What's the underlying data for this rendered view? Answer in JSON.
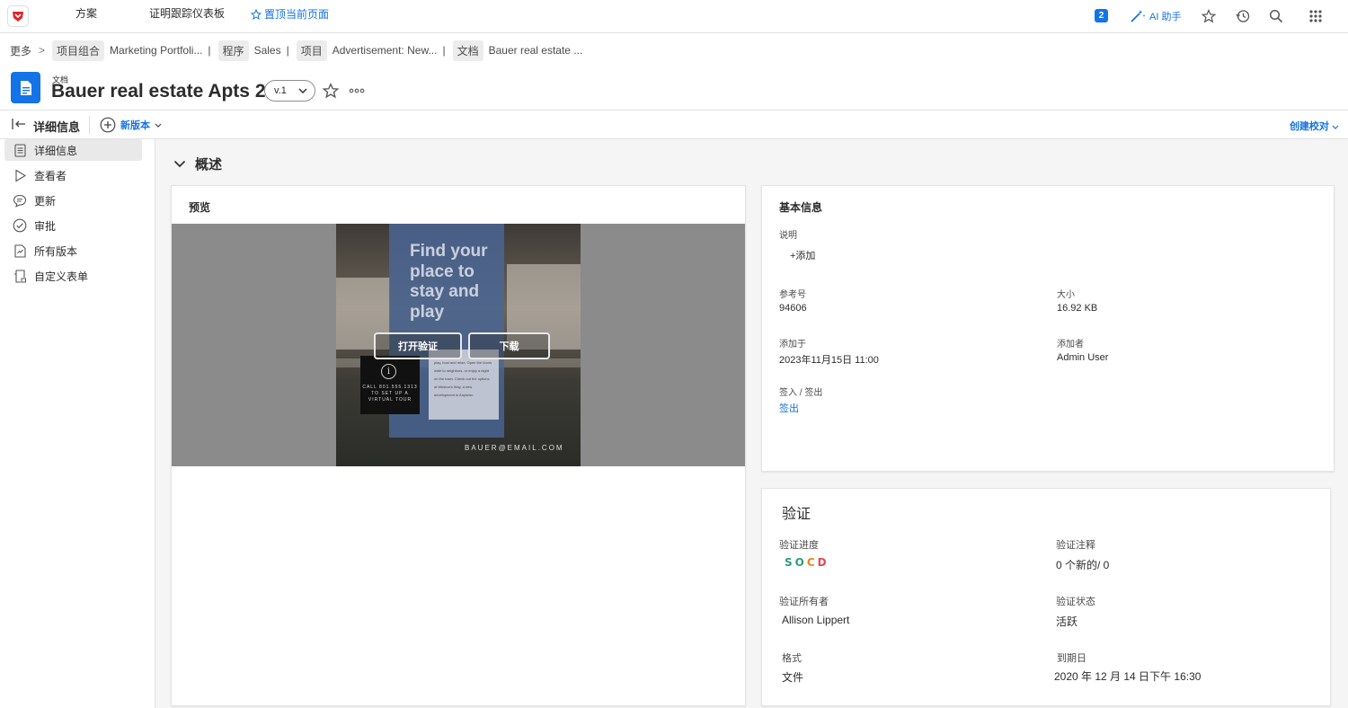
{
  "topbar": {
    "nav_plans": "方案",
    "nav_proof_dashboard": "证明跟踪仪表板",
    "pin_page": "置顶当前页面",
    "notification_count": "2",
    "ai_assistant": "AI 助手"
  },
  "breadcrumb": {
    "more": "更多",
    "items": [
      {
        "type": "项目组合",
        "name": "Marketing Portfoli..."
      },
      {
        "type": "程序",
        "name": "Sales"
      },
      {
        "type": "项目",
        "name": "Advertisement: New..."
      },
      {
        "type": "文档",
        "name": "Bauer real estate ..."
      }
    ]
  },
  "header": {
    "object_type": "文档",
    "title": "Bauer real estate Apts 2",
    "version": "v.1"
  },
  "subtoolbar": {
    "panel_title": "详细信息",
    "new_version": "新版本",
    "create_proof": "创建校对"
  },
  "leftnav": {
    "items": [
      {
        "label": "详细信息",
        "icon": "document-icon"
      },
      {
        "label": "查看者",
        "icon": "play-icon"
      },
      {
        "label": "更新",
        "icon": "comment-icon"
      },
      {
        "label": "审批",
        "icon": "check-circle-icon"
      },
      {
        "label": "所有版本",
        "icon": "versions-icon"
      },
      {
        "label": "自定义表单",
        "icon": "form-icon"
      }
    ]
  },
  "overview": {
    "title": "概述"
  },
  "preview": {
    "title": "预览",
    "open_proof": "打开验证",
    "download": "下载",
    "poster_tagline": "Find your place to stay and play",
    "poster_body": "play, host and relax. Open the doors wide to neighbors, or enjoy a night on the town. Check out the options at Weston's Way, a new development in Anytown.",
    "poster_call": "CALL 801.555.1313 TO SET UP A VIRTUAL TOUR",
    "poster_email": "BAUER@EMAIL.COM"
  },
  "basic_info": {
    "title": "基本信息",
    "description_label": "说明",
    "add_label": "+添加",
    "ref_label": "参考号",
    "ref_value": "94606",
    "size_label": "大小",
    "size_value": "16.92 KB",
    "added_on_label": "添加于",
    "added_on_value": "2023年11月15日 11:00",
    "added_by_label": "添加者",
    "added_by_value": "Admin User",
    "checkin_label": "签入 / 签出",
    "checkout_link": "签出"
  },
  "proof": {
    "title": "验证",
    "progress_label": "验证进度",
    "progress_letters": [
      "S",
      "O",
      "C",
      "D"
    ],
    "comments_label": "验证注释",
    "comments_value": "0 个新的/ 0",
    "owner_label": "验证所有者",
    "owner_value": "Allison Lippert",
    "status_label": "验证状态",
    "status_value": "活跃",
    "format_label": "格式",
    "format_value": "文件",
    "deadline_label": "到期日",
    "deadline_value": "2020 年 12 月 14 日下午 16:30"
  },
  "colors": {
    "accent": "#1473e6",
    "logo_red": "#e0242b",
    "status_green": "#2d9d78",
    "status_orange": "#e68619",
    "status_red": "#e34850"
  }
}
